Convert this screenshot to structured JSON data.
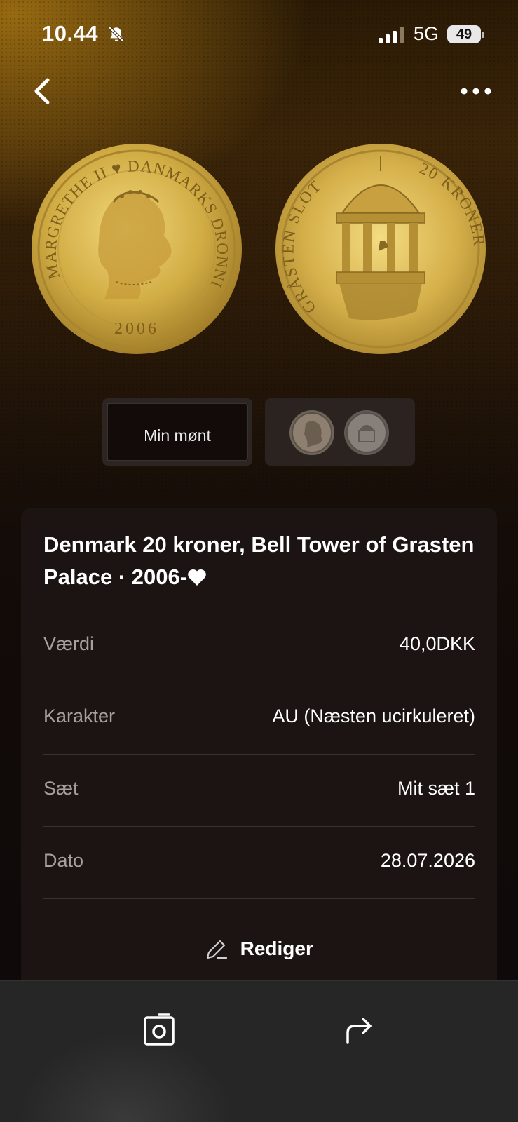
{
  "status_bar": {
    "time": "10.44",
    "network": "5G",
    "battery": "49",
    "icons": [
      "bell-slash-icon",
      "signal-icon",
      "battery-icon"
    ]
  },
  "nav": {
    "back_icon": "chevron-left-icon",
    "more_icon": "ellipsis-icon"
  },
  "selector": {
    "mine_label": "Min mønt",
    "reference_icon": "reference-coins-thumbnail"
  },
  "coin": {
    "title": "Denmark 20 kroner, Bell Tower of Grasten Palace · 2006-",
    "favorite_icon": "heart-icon",
    "obverse_legend": "MARGRETHE II ♥ DANMARKS DRONNING",
    "obverse_year": "2006",
    "reverse_legend": "GRÅSTEN SLOT",
    "reverse_value": "20 KRONER"
  },
  "details": [
    {
      "key": "Værdi",
      "value": "40,0DKK"
    },
    {
      "key": "Karakter",
      "value": "AU (Næsten ucirkuleret)"
    },
    {
      "key": "Sæt",
      "value": "Mit sæt 1"
    },
    {
      "key": "Dato",
      "value": "28.07.2026"
    }
  ],
  "actions": {
    "edit_label": "Rediger",
    "edit_icon": "pencil-icon",
    "photo_icon": "camera-frame-icon",
    "share_icon": "share-arrow-icon"
  },
  "colors": {
    "gold": "#c9a23a",
    "card_bg": "#1b1412",
    "muted_text": "#a6a19f"
  }
}
